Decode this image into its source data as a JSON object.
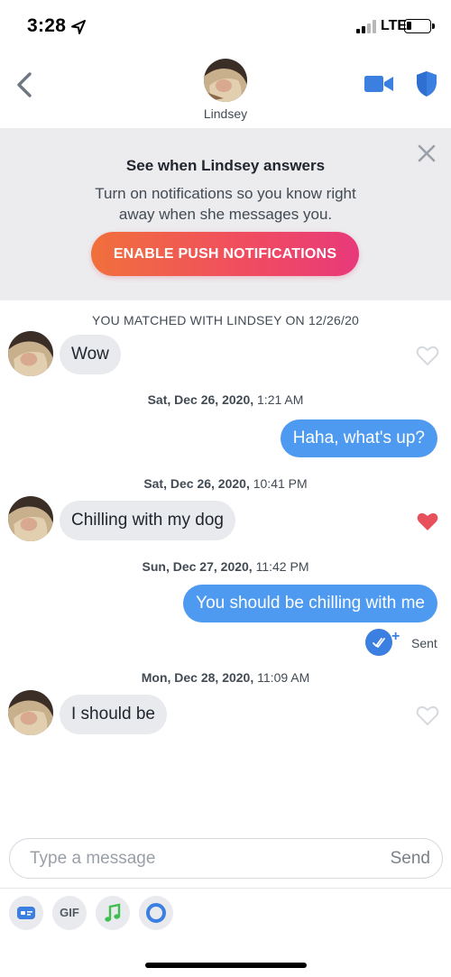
{
  "status_bar": {
    "time": "3:28",
    "network": "LTE",
    "icons": [
      "location-arrow-icon",
      "signal-icon",
      "battery-icon"
    ]
  },
  "header": {
    "name": "Lindsey",
    "icons": [
      "back-chevron-icon",
      "video-camera-icon",
      "shield-icon"
    ],
    "accent_color": "#3b7fe0"
  },
  "banner": {
    "title": "See when Lindsey answers",
    "body": "Turn on notifications so you know right away when she messages you.",
    "button_label": "ENABLE PUSH NOTIFICATIONS",
    "button_gradient": [
      "#f0703c",
      "#e8397a"
    ]
  },
  "chat": {
    "matched_text": "YOU MATCHED WITH LINDSEY ON 12/26/20",
    "timestamps": [
      {
        "date": "Sat, Dec 26, 2020,",
        "time": "1:21 AM"
      },
      {
        "date": "Sat, Dec 26, 2020,",
        "time": "10:41 PM"
      },
      {
        "date": "Sun, Dec 27, 2020,",
        "time": "11:42 PM"
      },
      {
        "date": "Mon, Dec 28, 2020,",
        "time": "11:09 AM"
      }
    ],
    "messages": [
      {
        "direction": "in",
        "text": "Wow",
        "liked": false
      },
      {
        "direction": "out",
        "text": "Haha, what's up?"
      },
      {
        "direction": "in",
        "text": "Chilling with my dog",
        "liked": true
      },
      {
        "direction": "out",
        "text": "You should be chilling with me"
      },
      {
        "direction": "in",
        "text": "I should be",
        "liked": false
      }
    ],
    "sent_status": "Sent",
    "like_color": "#e8505b",
    "outgoing_bubble_color": "#4d9af0"
  },
  "composer": {
    "placeholder": "Type a message",
    "send_label": "Send",
    "tools": [
      {
        "name": "sticker-card-icon"
      },
      {
        "name": "gif-button",
        "label": "GIF"
      },
      {
        "name": "music-note-icon"
      },
      {
        "name": "loop-icon"
      }
    ]
  }
}
